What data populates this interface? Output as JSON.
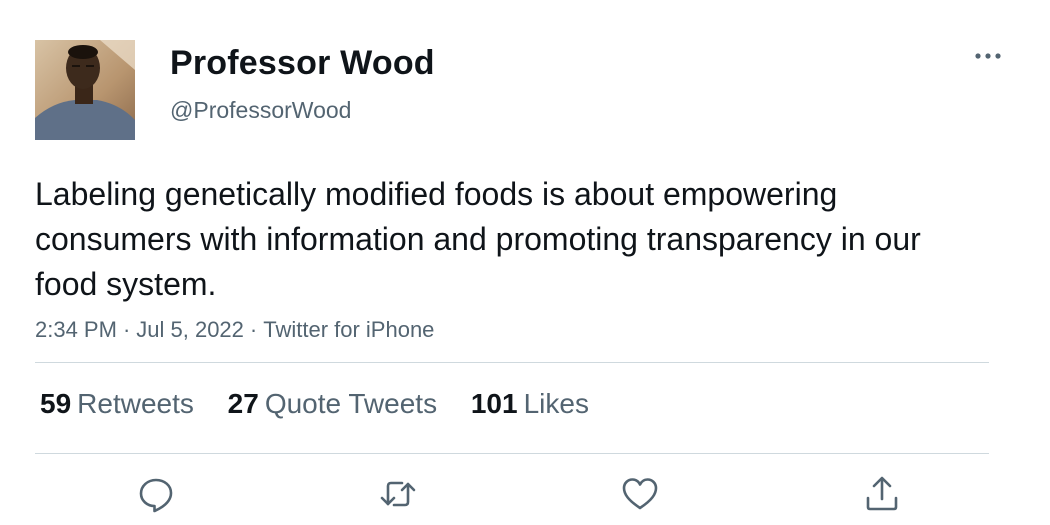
{
  "author": {
    "display_name": "Professor Wood",
    "handle": "@ProfessorWood"
  },
  "tweet": {
    "text": "Labeling genetically modified foods is about empowering consumers with information and promoting transparency in our food system.",
    "time": "2:34 PM",
    "separator": "·",
    "date": "Jul 5, 2022",
    "source": "Twitter for iPhone"
  },
  "stats": {
    "retweets_count": "59",
    "retweets_label": "Retweets",
    "quotes_count": "27",
    "quotes_label": "Quote Tweets",
    "likes_count": "101",
    "likes_label": "Likes"
  },
  "actions": {
    "reply": "reply-icon",
    "retweet": "retweet-icon",
    "like": "heart-icon",
    "share": "share-icon"
  },
  "colors": {
    "text_primary": "#0f1419",
    "text_secondary": "#536471",
    "divider": "#cfd9de"
  }
}
